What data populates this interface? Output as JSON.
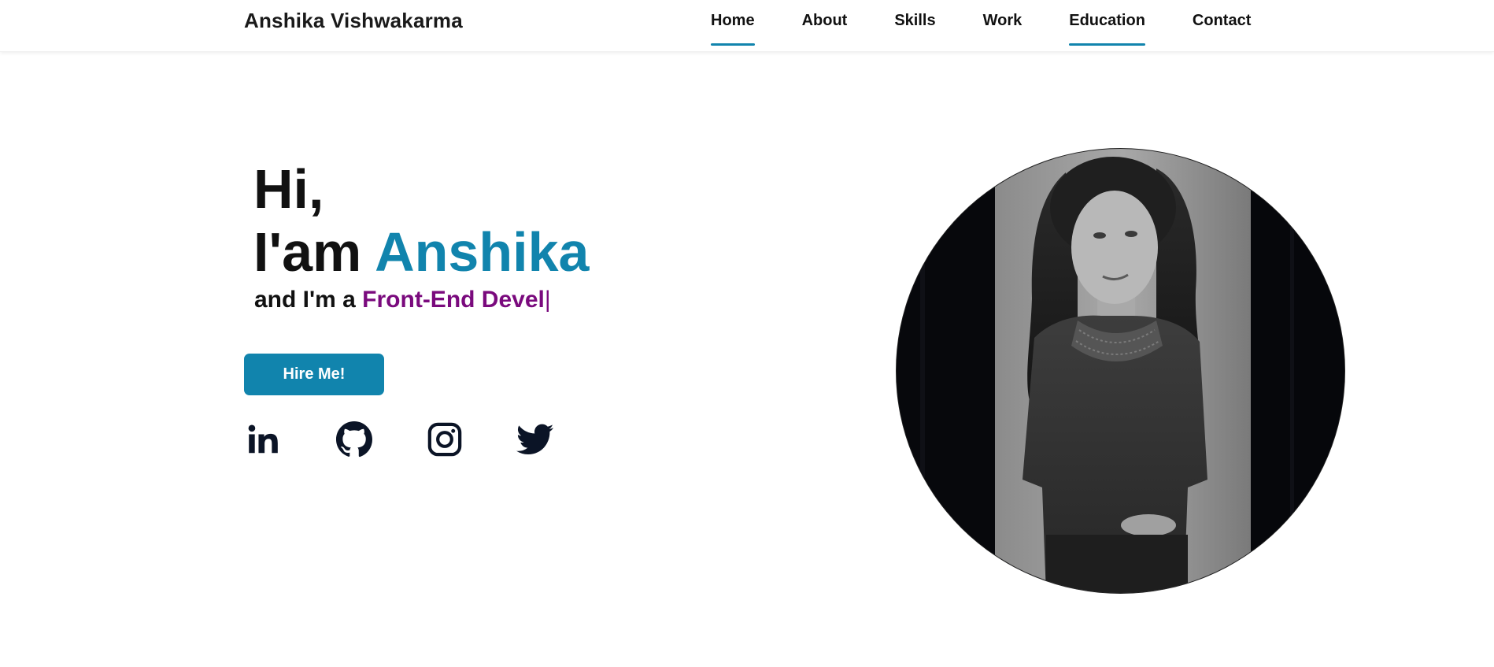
{
  "header": {
    "brand": "Anshika Vishwakarma",
    "nav": [
      {
        "label": "Home",
        "active": true
      },
      {
        "label": "About",
        "active": false
      },
      {
        "label": "Skills",
        "active": false
      },
      {
        "label": "Work",
        "active": false
      },
      {
        "label": "Education",
        "active": true
      },
      {
        "label": "Contact",
        "active": false
      }
    ]
  },
  "hero": {
    "greeting": "Hi,",
    "intro_prefix": "I'am ",
    "name": "Anshika",
    "role_prefix": "and I'm a ",
    "role_typed": "Front-End Devel",
    "cursor": "|",
    "hire_button": "Hire Me!"
  },
  "socials": [
    {
      "icon": "linkedin-icon"
    },
    {
      "icon": "github-icon"
    },
    {
      "icon": "instagram-icon"
    },
    {
      "icon": "twitter-icon"
    }
  ],
  "colors": {
    "accent": "#1184ad",
    "role_text": "#7a0a7d",
    "text": "#111111",
    "icon": "#0b1426"
  }
}
